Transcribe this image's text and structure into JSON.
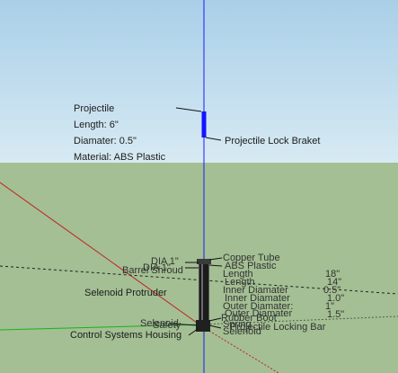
{
  "colors": {
    "sky": "#bfe0ef",
    "ground": "#a3bf93",
    "axis_blue": "#1a1aff",
    "axis_red": "#c22020",
    "axis_green": "#16b516"
  },
  "projectile_note": {
    "title": "Projectile",
    "length": "Length: 6\"",
    "diameter": "Diamater: 0.5\"",
    "material": "Material: ABS Plastic"
  },
  "callouts": {
    "projectile_lock": "Projectile Lock Braket",
    "dia": "DIA 1\"",
    "barrel_shroud": "Barrel Shroud",
    "dia_overlap": "DIA 1\"",
    "copper_tube": "Copper Tube",
    "abs_plastic": "ABS Plastic",
    "length_a": "Length",
    "length_b": "Length",
    "inner_diameter_a": "Inner Diamater",
    "inner_diameter_b": "Inner Diamater",
    "outer_diameter_a": "Outer Diamater:",
    "outer_diameter_b": "Outer Diamater",
    "rubber_boot": "Rubber Boot",
    "projectile_locking_bar": "Projectile Locking Bar",
    "solenoid_protruder": "Selenoid Protruder",
    "safety": "Safety",
    "solenoid_short": "Selenoid",
    "solenoid_right": "Selenoid",
    "spring": "Spring",
    "control_housing": "Control Systems Housing"
  },
  "values": {
    "v_18": "18\"",
    "v_14": "14\"",
    "v_05": "0.5\"",
    "v_10": "1.0\"",
    "v_1": "1\"",
    "v_15": "1.5\""
  }
}
